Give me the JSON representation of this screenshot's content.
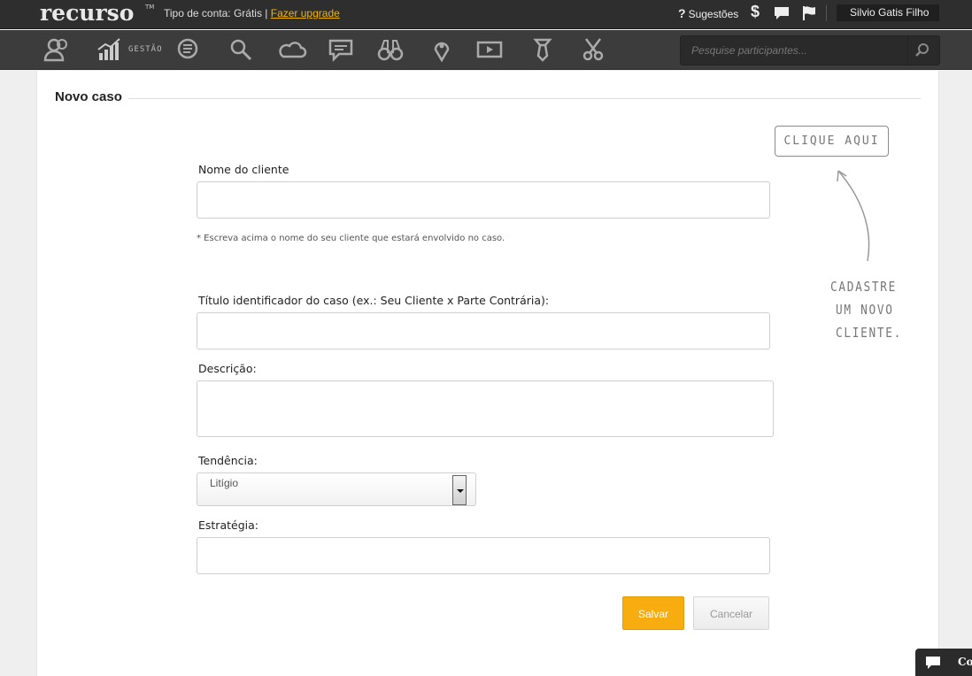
{
  "topbar": {
    "logo": "recurso",
    "logo_tm": "TM",
    "account_label": "Tipo de conta: Grátis |",
    "upgrade_link": "Fazer upgrade",
    "suggestions": "Sugestões",
    "suggestions_icon": "question-mark",
    "dollar_icon": "$",
    "username": "Silvio Gatis Filho"
  },
  "navbar": {
    "gestao_label": "GESTÃO",
    "items": [
      "people-icon",
      "chart-icon",
      "billing-icon",
      "search-icon",
      "cloud-icon",
      "message-icon",
      "binoculars-icon",
      "map-pin-icon",
      "video-icon",
      "tie-icon",
      "scissors-icon"
    ],
    "search_placeholder": "Pesquise participantes..."
  },
  "page": {
    "title": "Novo caso"
  },
  "form": {
    "client_label": "Nome do cliente",
    "client_value": "",
    "client_hint": "* Escreva acima o nome do seu cliente que estará envolvido no caso.",
    "case_title_label": "Título identificador do caso (ex.: Seu Cliente x Parte Contrária):",
    "case_title_value": "",
    "description_label": "Descrição:",
    "description_value": "",
    "tendency_label": "Tendência:",
    "tendency_selected": "Litígio",
    "strategy_label": "Estratégia:",
    "strategy_value": "",
    "save_button": "Salvar",
    "cancel_button": "Cancelar"
  },
  "side_hint": {
    "button": "CLIQUE AQUI",
    "line1": "CADASTRE",
    "line2": "UM NOVO",
    "line3": "CLIENTE."
  },
  "chat": {
    "label": "Co"
  },
  "colors": {
    "accent": "#f7ac0f",
    "link": "#f0b400",
    "topbar_bg": "#2e2e2e",
    "navbar_bg": "#3c3c3c"
  }
}
